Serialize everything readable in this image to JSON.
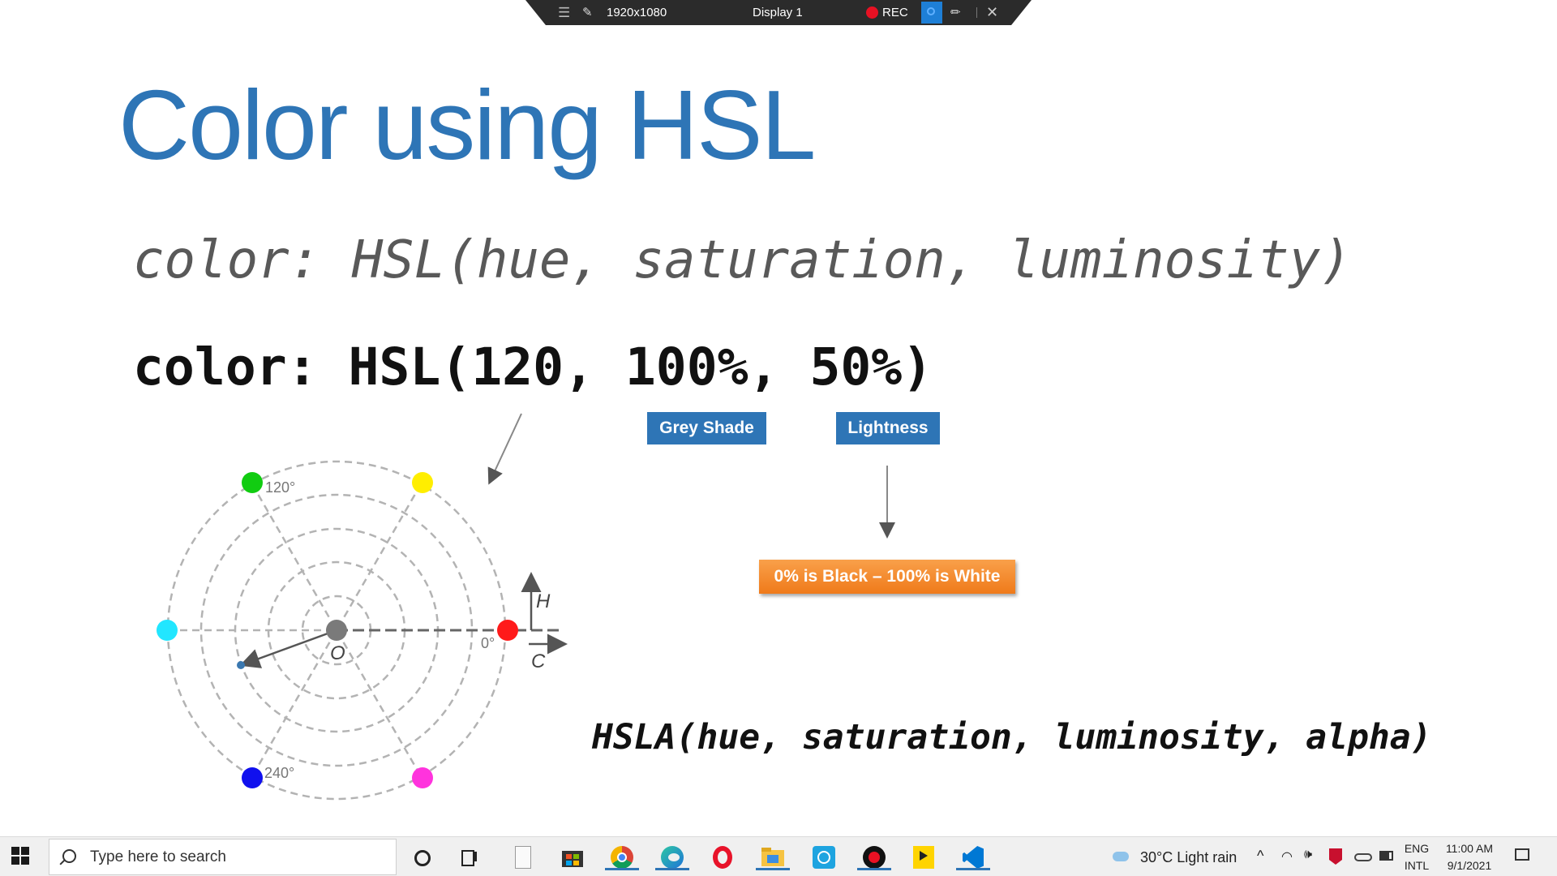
{
  "recorder": {
    "resolution": "1920x1080",
    "display": "Display 1",
    "rec_label": "REC"
  },
  "slide": {
    "title": "Color using HSL",
    "syntax_generic": "color: HSL(hue, saturation, luminosity)",
    "syntax_example": "color: HSL(120, 100%, 50%)",
    "tag_saturation": "Grey Shade",
    "tag_lightness": "Lightness",
    "lightness_note": "0% is Black – 100% is White",
    "hsla_syntax": "HSLA(hue, saturation, luminosity, alpha)"
  },
  "diagram": {
    "label_120": "120°",
    "label_240": "240°",
    "label_0": "0°",
    "label_origin": "O",
    "label_h": "H",
    "label_c": "C",
    "hue_colors": {
      "red": "#ff1a1a",
      "yellow": "#ffee00",
      "green": "#11cc11",
      "cyan": "#22e6ff",
      "blue": "#1010ee",
      "magenta": "#ff33dd"
    }
  },
  "taskbar": {
    "search_placeholder": "Type here to search",
    "weather": "30°C  Light rain",
    "lang_top": "ENG",
    "lang_bottom": "INTL",
    "time": "11:00 AM",
    "date": "9/1/2021"
  },
  "accent_color": "#2e75b6"
}
